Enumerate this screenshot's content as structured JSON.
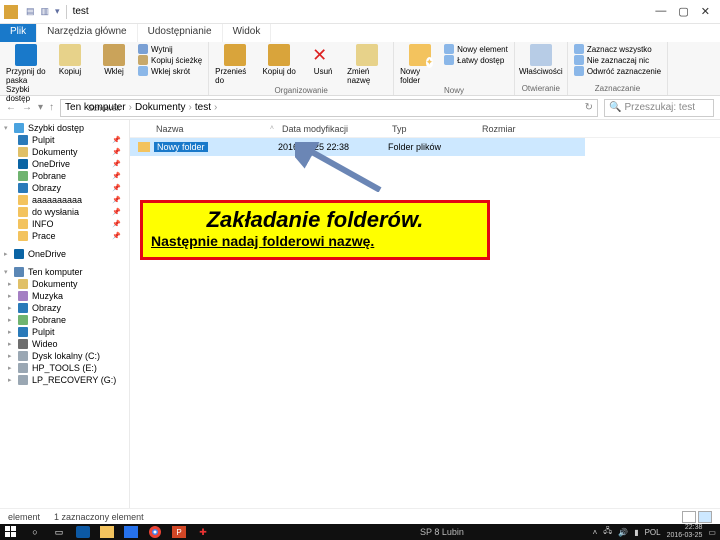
{
  "window": {
    "title": "test"
  },
  "win_controls": {
    "min": "—",
    "max": "▢",
    "close": "✕"
  },
  "tabs": {
    "file": "Plik",
    "home": "Narzędzia główne",
    "share": "Udostępnianie",
    "view": "Widok"
  },
  "ribbon": {
    "pin": "Przypnij do paska Szybki dostęp",
    "copy": "Kopiuj",
    "paste": "Wklej",
    "cut": "Wytnij",
    "copy_path": "Kopiuj ścieżkę",
    "paste_short": "Wklej skrót",
    "clipboard_grp": "Schowek",
    "move": "Przenieś do",
    "copy_to": "Kopiuj do",
    "delete": "Usuń",
    "rename": "Zmień nazwę",
    "org_grp": "Organizowanie",
    "new_item": "Nowy element",
    "easy_access": "Łatwy dostęp",
    "new_folder": "Nowy folder",
    "new_grp": "Nowy",
    "properties": "Właściwości",
    "open_grp": "Otwieranie",
    "sel_all": "Zaznacz wszystko",
    "sel_none": "Nie zaznaczaj nic",
    "sel_inv": "Odwróć zaznaczenie",
    "sel_grp": "Zaznaczanie"
  },
  "breadcrumb": {
    "b1": "Ten komputer",
    "b2": "Dokumenty",
    "b3": "test",
    "sep": "›",
    "refresh": "↻"
  },
  "search": {
    "placeholder": "Przeszukaj: test"
  },
  "columns": {
    "name": "Nazwa",
    "date": "Data modyfikacji",
    "type": "Typ",
    "size": "Rozmiar"
  },
  "file_row": {
    "name": "Nowy folder",
    "date": "2016-03-25 22:38",
    "type": "Folder plików",
    "size": ""
  },
  "sidebar": {
    "quick": "Szybki dostęp",
    "items_quick": [
      "Pulpit",
      "Dokumenty",
      "OneDrive",
      "Pobrane",
      "Obrazy",
      "aaaaaaaaaa",
      "do wysłania",
      "INFO",
      "Prace"
    ],
    "onedrive": "OneDrive",
    "thispc": "Ten komputer",
    "items_pc": [
      "Dokumenty",
      "Muzyka",
      "Obrazy",
      "Pobrane",
      "Pulpit",
      "Wideo",
      "Dysk lokalny (C:)",
      "HP_TOOLS (E:)",
      "LP_RECOVERY (G:)"
    ]
  },
  "status": {
    "a": "element",
    "b": "1 zaznaczony element"
  },
  "callout": {
    "t1": "Zakładanie folderów.",
    "t2": "Następnie nadaj folderowi nazwę."
  },
  "taskbar": {
    "center": "SP 8  Lubin",
    "lang": "POL",
    "time": "22:38",
    "date": "2016-03-25"
  },
  "colors": {
    "blue": "#1979ca",
    "folder": "#f3c35e",
    "gray": "#888888",
    "edge": "#0c59a4",
    "store": "#2672ec",
    "chrome1": "#ea4335",
    "ppt": "#d24726"
  }
}
